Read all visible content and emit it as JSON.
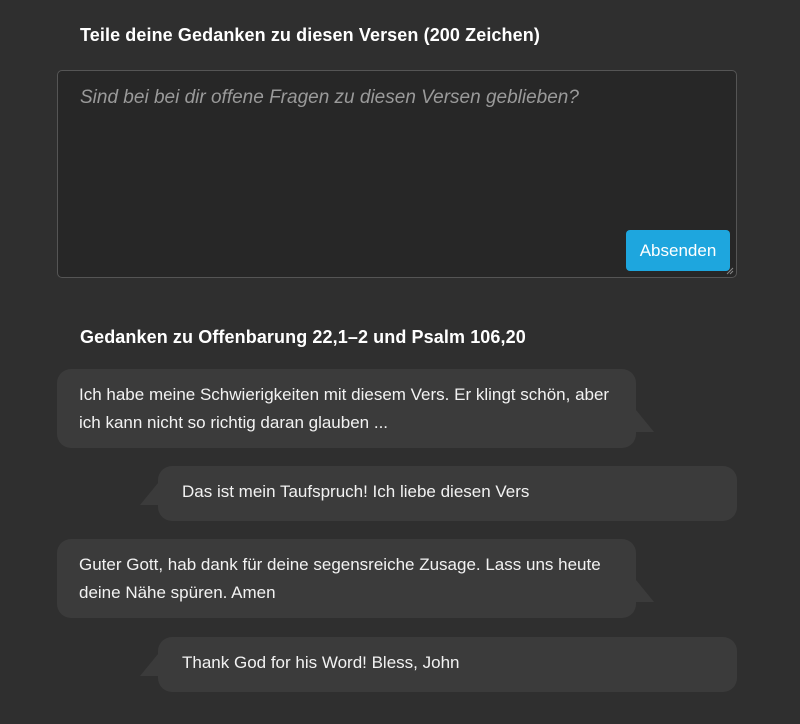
{
  "share_section": {
    "heading": "Teile deine Gedanken zu diesen Versen (200 Zeichen)",
    "input_value": "",
    "input_placeholder": "Sind bei bei dir offene Fragen zu diesen Versen geblieben?",
    "send_label": "Absenden"
  },
  "thoughts_section": {
    "heading": "Gedanken zu Offenbarung 22,1–2 und Psalm 106,20",
    "comments": [
      {
        "side": "left",
        "text": "Ich habe meine Schwierigkeiten mit diesem Vers. Er klingt schön, aber ich kann nicht so richtig daran glauben ..."
      },
      {
        "side": "right",
        "text": "Das ist mein Taufspruch! Ich liebe diesen Vers"
      },
      {
        "side": "left",
        "text": "Guter Gott, hab dank für deine segensreiche Zusage. Lass uns heute deine Nähe spüren. Amen"
      },
      {
        "side": "right",
        "text": "Thank God for his Word! Bless, John"
      }
    ]
  },
  "colors": {
    "background": "#2f2f2f",
    "input_background": "#272727",
    "bubble_background": "#3b3b3b",
    "accent": "#1ea6de"
  }
}
